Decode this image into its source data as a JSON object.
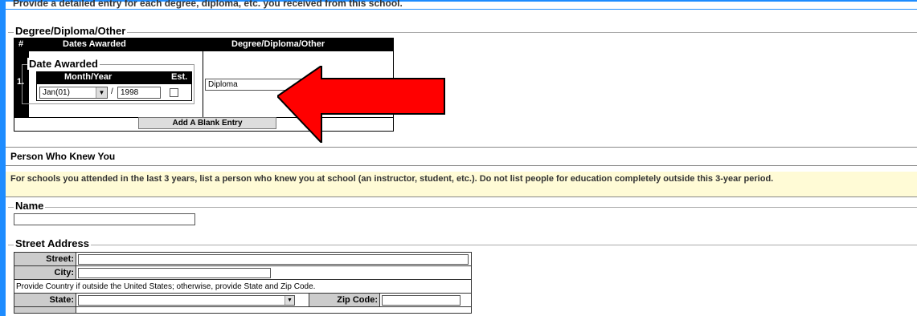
{
  "top_instruction": "Provide a detailed entry for each degree, diploma, etc. you received from this school.",
  "degree_section": {
    "legend": "Degree/Diploma/Other",
    "headers": {
      "num": "#",
      "dates": "Dates Awarded",
      "degree": "Degree/Diploma/Other"
    },
    "entry": {
      "number": "1.",
      "date_legend": "Date Awarded",
      "month_year_header": "Month/Year",
      "est_header": "Est.",
      "month_value": "Jan(01)",
      "separator": "/",
      "year_value": "1998",
      "degree_value": "Diploma"
    },
    "add_button_label": "Add A Blank Entry"
  },
  "person_section": {
    "title": "Person Who Knew You",
    "note": "For schools you attended in the last 3 years, list a person who knew you at school (an instructor, student, etc.). Do not list people for education completely outside this 3-year period.",
    "name_legend": "Name",
    "name_value": ""
  },
  "address_section": {
    "legend": "Street Address",
    "street_label": "Street:",
    "city_label": "City:",
    "country_note": "Provide Country if outside the United States; otherwise, provide State and Zip Code.",
    "state_label": "State:",
    "zip_label": "Zip Code:"
  },
  "colors": {
    "accent": "#1e8cff",
    "arrow": "#ff0000",
    "note_bg": "#fffbd6",
    "header_bg": "#000000"
  }
}
